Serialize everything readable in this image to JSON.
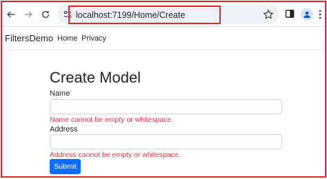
{
  "browser": {
    "url": "localhost:7199/Home/Create"
  },
  "navbar": {
    "brand": "FiltersDemo",
    "links": [
      "Home",
      "Privacy"
    ]
  },
  "form": {
    "heading": "Create Model",
    "fields": [
      {
        "label": "Name",
        "value": "",
        "error": "Name cannot be empty or whitespace."
      },
      {
        "label": "Address",
        "value": "",
        "error": "Address cannot be empty or whitespace."
      }
    ],
    "submit_label": "Submit"
  },
  "colors": {
    "highlight_border": "#e0262d",
    "error_text": "#dc3545",
    "primary_button": "#0d6efd"
  },
  "icons": [
    "back-arrow-icon",
    "forward-arrow-icon",
    "reload-icon",
    "site-settings-icon",
    "bookmark-star-icon",
    "side-panel-icon",
    "profile-icon",
    "more-menu-icon"
  ]
}
